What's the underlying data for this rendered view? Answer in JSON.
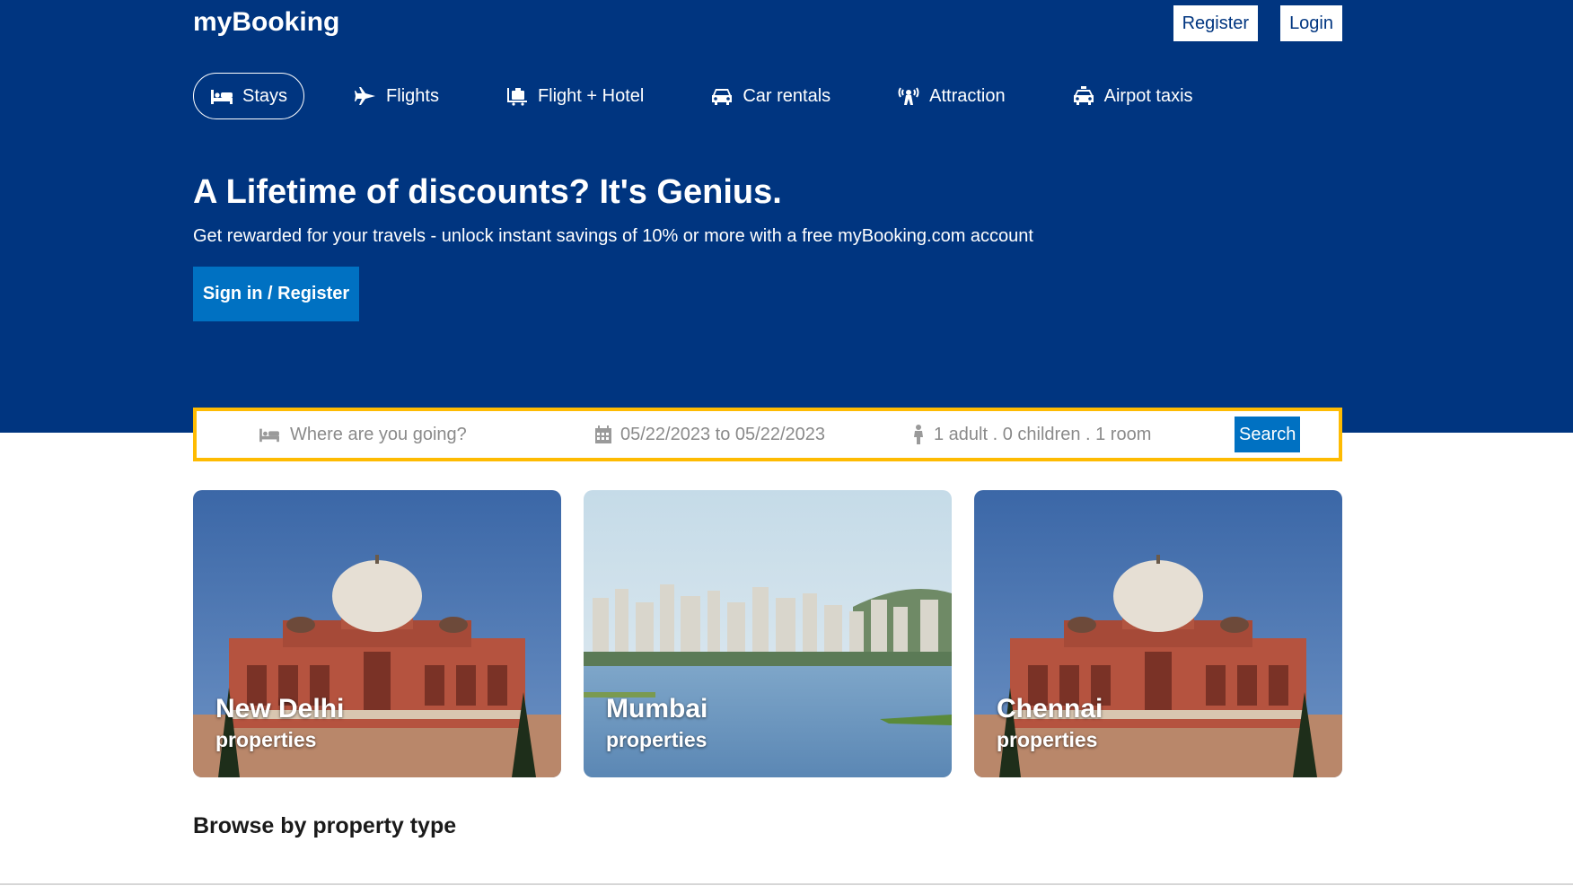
{
  "header": {
    "logo": "myBooking",
    "register_label": "Register",
    "login_label": "Login"
  },
  "nav": [
    {
      "label": "Stays",
      "icon": "bed-icon",
      "active": true
    },
    {
      "label": "Flights",
      "icon": "plane-icon",
      "active": false
    },
    {
      "label": "Flight + Hotel",
      "icon": "luggage-icon",
      "active": false
    },
    {
      "label": "Car rentals",
      "icon": "car-icon",
      "active": false
    },
    {
      "label": "Attraction",
      "icon": "attraction-icon",
      "active": false
    },
    {
      "label": "Airpot taxis",
      "icon": "taxi-icon",
      "active": false
    }
  ],
  "hero": {
    "headline": "A Lifetime of discounts? It's Genius.",
    "subline": "Get rewarded for your travels - unlock instant savings of 10% or more with a free myBooking.com account",
    "signin_label": "Sign in / Register"
  },
  "search": {
    "destination_placeholder": "Where are you going?",
    "dates": "05/22/2023 to 05/22/2023",
    "guests": "1 adult . 0 children . 1 room",
    "button_label": "Search"
  },
  "featured": [
    {
      "city": "New Delhi",
      "sub": "properties"
    },
    {
      "city": "Mumbai",
      "sub": "properties"
    },
    {
      "city": "Chennai",
      "sub": "properties"
    }
  ],
  "browse_heading": "Browse by property type",
  "colors": {
    "brand_blue": "#003580",
    "accent_blue": "#0071c2",
    "search_border": "#febb02"
  }
}
